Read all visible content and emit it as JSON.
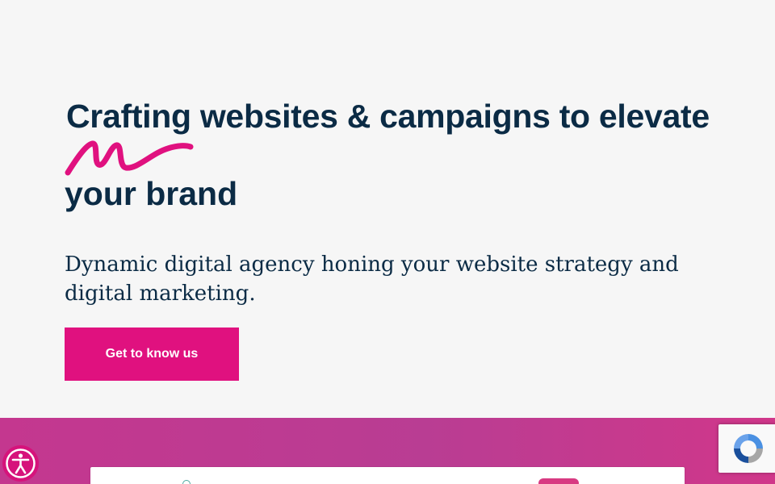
{
  "hero": {
    "headline_line1": "Crafting websites & campaigns to elevate",
    "headline_line2": "your brand",
    "subhead": "Dynamic digital agency honing your website strategy and digital marketing.",
    "cta_label": "Get to know us"
  },
  "decor": {
    "scribble_icon": "handdrawn-scribble",
    "accessibility_icon": "accessibility-person-icon",
    "recaptcha_icon": "recaptcha-logo"
  },
  "colors": {
    "navy": "#0b2b45",
    "magenta": "#e0117f",
    "band": "#c4378f",
    "background": "#f6f6f6"
  }
}
